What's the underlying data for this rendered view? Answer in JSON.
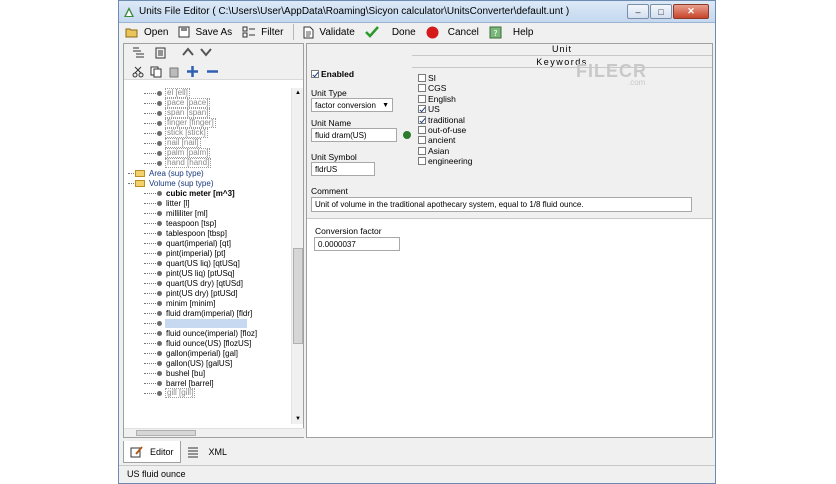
{
  "window": {
    "title": "Units File Editor  ( C:\\Users\\User\\AppData\\Roaming\\Sicyon calculator\\UnitsConverter\\default.unt )"
  },
  "toolbar": {
    "open": "Open",
    "save_as": "Save As",
    "filter": "Filter",
    "validate": "Validate",
    "done": "Done",
    "cancel": "Cancel",
    "help": "Help"
  },
  "tree": {
    "rows": [
      {
        "text": "el [ell]",
        "kind": "boxed"
      },
      {
        "text": "pace [pace]",
        "kind": "boxed"
      },
      {
        "text": "span [span]",
        "kind": "boxed"
      },
      {
        "text": "finger [finger]",
        "kind": "boxed"
      },
      {
        "text": "stick [stick]",
        "kind": "boxed"
      },
      {
        "text": "nail [nail]",
        "kind": "boxed"
      },
      {
        "text": "palm [palm]",
        "kind": "boxed"
      },
      {
        "text": "hand [hand]",
        "kind": "boxed"
      },
      {
        "text": "Area (sup type)",
        "kind": "folder"
      },
      {
        "text": "Volume (sup type)",
        "kind": "folder"
      },
      {
        "text": "cubic meter [m^3]",
        "kind": "bold"
      },
      {
        "text": "litter [l]",
        "kind": "item"
      },
      {
        "text": "milliliter [ml]",
        "kind": "item"
      },
      {
        "text": "teaspoon [tsp]",
        "kind": "item"
      },
      {
        "text": "tablespoon [tbsp]",
        "kind": "item"
      },
      {
        "text": "quart(imperial) [qt]",
        "kind": "item"
      },
      {
        "text": "pint(imperial) [pt]",
        "kind": "item"
      },
      {
        "text": "quart(US liq) [qtUSq]",
        "kind": "item"
      },
      {
        "text": "pint(US liq) [ptUSq]",
        "kind": "item"
      },
      {
        "text": "quart(US dry) [qtUSd]",
        "kind": "item"
      },
      {
        "text": "pint(US dry) [ptUSd]",
        "kind": "item"
      },
      {
        "text": "minim [minim]",
        "kind": "item"
      },
      {
        "text": "fluid dram(imperial) [fldr]",
        "kind": "item"
      },
      {
        "text": "fluid dram(US) [fldrUS]",
        "kind": "sel"
      },
      {
        "text": "fluid ounce(imperial) [floz]",
        "kind": "item"
      },
      {
        "text": "fluid ounce(US) [flozUS]",
        "kind": "item"
      },
      {
        "text": "gallon(imperial) [gal]",
        "kind": "item"
      },
      {
        "text": "gallon(US) [galUS]",
        "kind": "item"
      },
      {
        "text": "bushel [bu]",
        "kind": "item"
      },
      {
        "text": "barrel [barrel]",
        "kind": "item"
      },
      {
        "text": "gill [gill]",
        "kind": "boxed"
      }
    ]
  },
  "form": {
    "enabled_label": "Enabled",
    "unit_type_label": "Unit Type",
    "unit_type_value": "factor conversion",
    "unit_name_label": "Unit Name",
    "unit_name_value": "fluid dram(US)",
    "unit_symbol_label": "Unit Symbol",
    "unit_symbol_value": "fldrUS",
    "comment_label": "Comment",
    "comment_value": "Unit of volume in the traditional apothecary system, equal to 1/8 fluid ounce.",
    "conversion_label": "Conversion factor",
    "conversion_value": "0.0000037"
  },
  "unit_header": "Unit",
  "keywords": {
    "title": "Keywords",
    "items": [
      {
        "label": "SI",
        "checked": false
      },
      {
        "label": "CGS",
        "checked": false
      },
      {
        "label": "English",
        "checked": false
      },
      {
        "label": "US",
        "checked": true
      },
      {
        "label": "traditional",
        "checked": true
      },
      {
        "label": "out-of-use",
        "checked": false
      },
      {
        "label": "ancient",
        "checked": false
      },
      {
        "label": "Asian",
        "checked": false
      },
      {
        "label": "engineering",
        "checked": false
      }
    ]
  },
  "tabs": {
    "editor": "Editor",
    "xml": "XML"
  },
  "status": {
    "text": "US fluid ounce"
  },
  "watermark": {
    "main": "FILECR",
    "sub": ".com"
  }
}
